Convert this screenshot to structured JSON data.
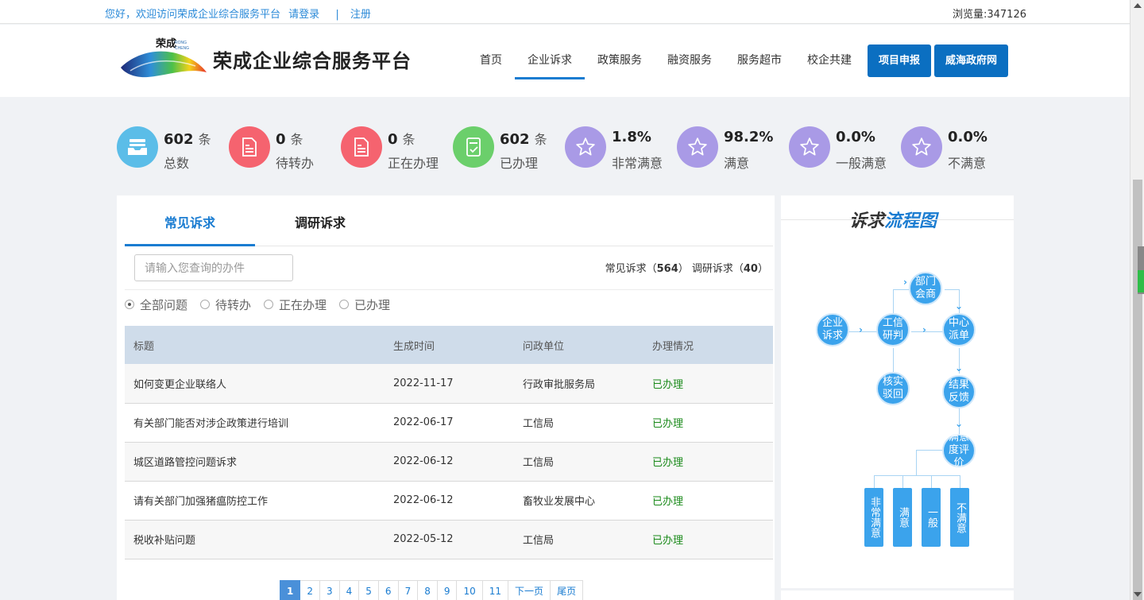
{
  "topbar": {
    "welcome": "您好，欢迎访问荣成企业综合服务平台",
    "login": "请登录",
    "separator": "|",
    "register": "注册",
    "visits": "浏览量:347126"
  },
  "header": {
    "logo_text": "荣成 RONG CHENG",
    "title": "荣成企业综合服务平台",
    "nav": [
      "首页",
      "企业诉求",
      "政策服务",
      "融资服务",
      "服务超市",
      "校企共建"
    ],
    "buttons": [
      "项目申报",
      "威海政府网"
    ]
  },
  "stats": [
    {
      "num": "602",
      "unit": "条",
      "label": "总数",
      "color": "#5bbde8",
      "icon": "inbox-icon"
    },
    {
      "num": "0",
      "unit": "条",
      "label": "待转办",
      "color": "#f5636f",
      "icon": "document-icon"
    },
    {
      "num": "0",
      "unit": "条",
      "label": "正在办理",
      "color": "#f5636f",
      "icon": "document-icon"
    },
    {
      "num": "602",
      "unit": "条",
      "label": "已办理",
      "color": "#6bcf6b",
      "icon": "checklist-icon"
    },
    {
      "num": "1.8%",
      "unit": "",
      "label": "非常满意",
      "color": "#a99ae6",
      "icon": "star-icon"
    },
    {
      "num": "98.2%",
      "unit": "",
      "label": "满意",
      "color": "#a99ae6",
      "icon": "star-icon"
    },
    {
      "num": "0.0%",
      "unit": "",
      "label": "一般满意",
      "color": "#a99ae6",
      "icon": "star-icon"
    },
    {
      "num": "0.0%",
      "unit": "",
      "label": "不满意",
      "color": "#a99ae6",
      "icon": "star-icon"
    }
  ],
  "tabs": [
    "常见诉求",
    "调研诉求"
  ],
  "search": {
    "placeholder": "请输入您查询的办件"
  },
  "counts": {
    "common_label": "常见诉求（",
    "common": "564",
    "research_label": "） 调研诉求（",
    "research": "40",
    "end": "）"
  },
  "filters": [
    "全部问题",
    "待转办",
    "正在办理",
    "已办理"
  ],
  "table": {
    "headers": [
      "标题",
      "生成时间",
      "问政单位",
      "办理情况"
    ],
    "rows": [
      [
        "如何变更企业联络人",
        "2022-11-17",
        "行政审批服务局",
        "已办理"
      ],
      [
        "有关部门能否对涉企政策进行培训",
        "2022-06-17",
        "工信局",
        "已办理"
      ],
      [
        "城区道路管控问题诉求",
        "2022-06-12",
        "工信局",
        "已办理"
      ],
      [
        "请有关部门加强猪瘟防控工作",
        "2022-06-12",
        "畜牧业发展中心",
        "已办理"
      ],
      [
        "税收补贴问题",
        "2022-05-12",
        "工信局",
        "已办理"
      ]
    ]
  },
  "pager": [
    "1",
    "2",
    "3",
    "4",
    "5",
    "6",
    "7",
    "8",
    "9",
    "10",
    "11",
    "下一页",
    "尾页"
  ],
  "flow": {
    "title_a": "诉求",
    "title_b": "流程图",
    "nodes": {
      "start": "企业诉求",
      "research": "工信研判",
      "dept": "部门会商",
      "center": "中心派单",
      "verify": "核实驳回",
      "feedback": "结果反馈",
      "evaluate": "满意度评价"
    },
    "bars": [
      "非常满意",
      "满意",
      "一般",
      "不满意"
    ]
  }
}
